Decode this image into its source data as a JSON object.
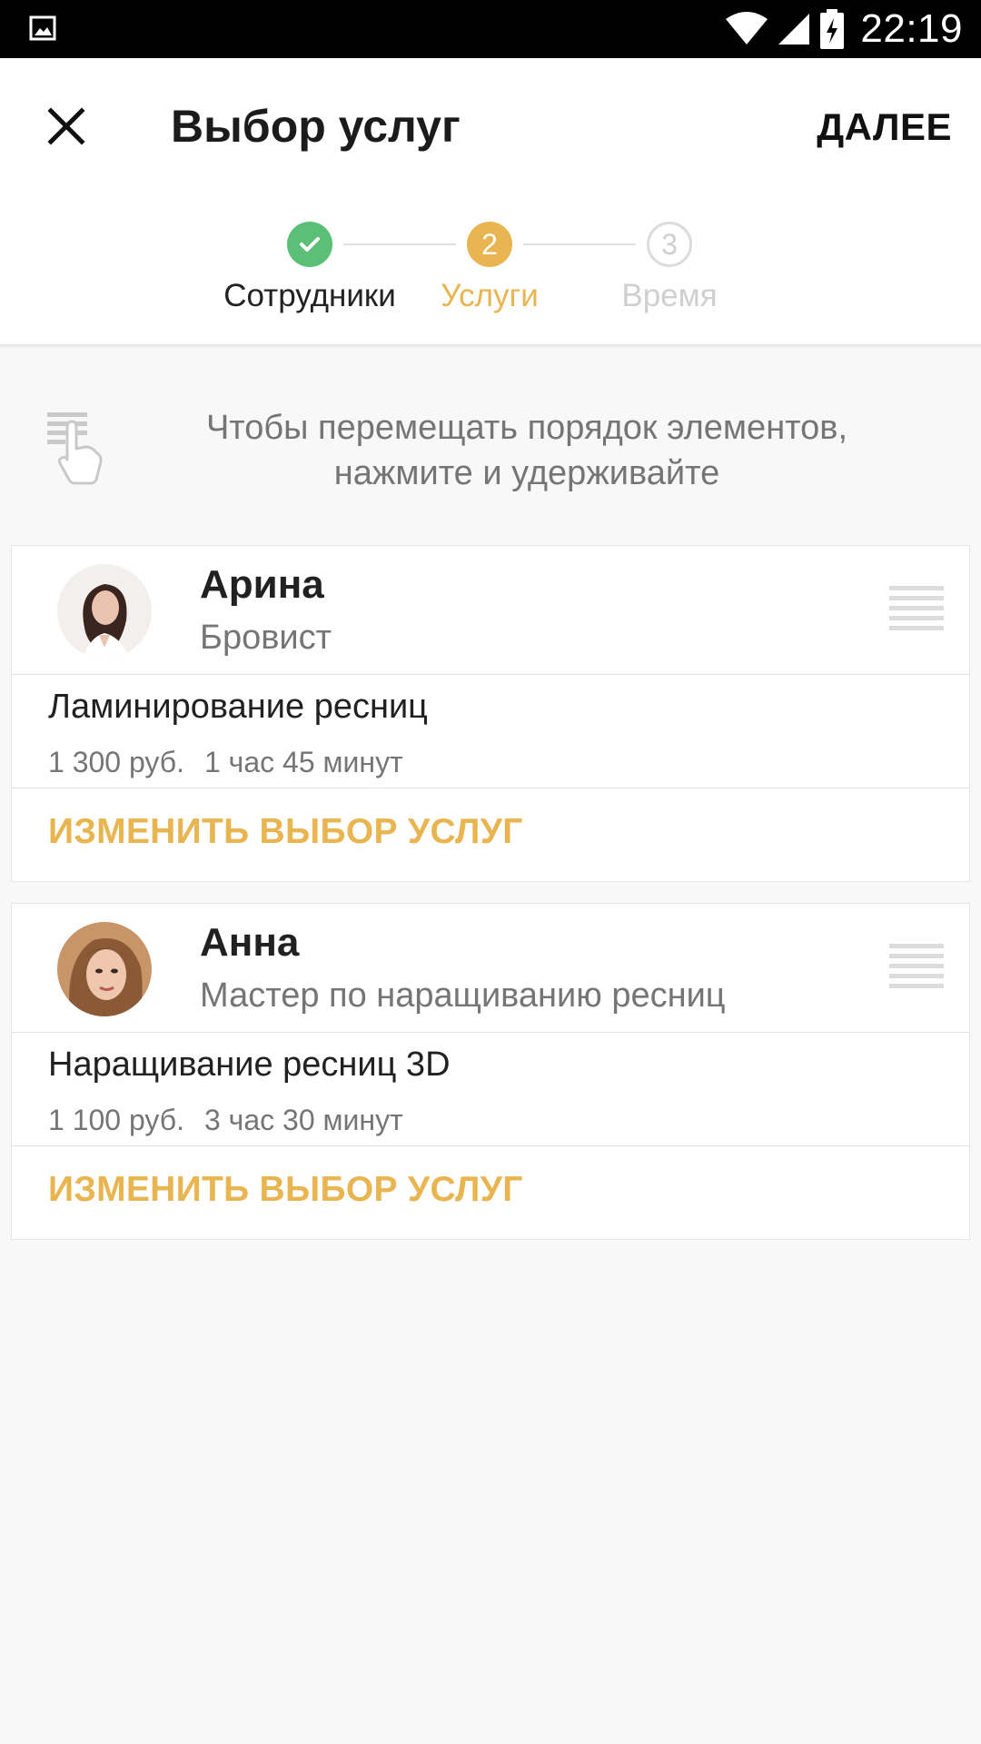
{
  "status_bar": {
    "time": "22:19",
    "icons": [
      "image-icon",
      "wifi-icon",
      "signal-icon",
      "battery-charging-icon"
    ]
  },
  "app_bar": {
    "title": "Выбор услуг",
    "next_label": "ДАЛЕЕ",
    "close_icon": "close-icon"
  },
  "stepper": {
    "steps": [
      {
        "label": "Сотрудники",
        "marker": "",
        "state": "done"
      },
      {
        "label": "Услуги",
        "marker": "2",
        "state": "active"
      },
      {
        "label": "Время",
        "marker": "3",
        "state": "future"
      }
    ]
  },
  "hint": {
    "text_line1": "Чтобы перемещать порядок элементов,",
    "text_line2": "нажмите и удерживайте",
    "icon": "touch-hold-icon"
  },
  "cards": [
    {
      "name": "Арина",
      "role": "Бровист",
      "service_name": "Ламинирование ресниц",
      "price": "1 300 руб.",
      "duration": "1 час 45 минут",
      "change_label": "ИЗМЕНИТЬ ВЫБОР УСЛУГ"
    },
    {
      "name": "Анна",
      "role": "Мастер по наращиванию ресниц",
      "service_name": "Наращивание ресниц 3D",
      "price": "1 100 руб.",
      "duration": "3 час 30 минут",
      "change_label": "ИЗМЕНИТЬ ВЫБОР УСЛУГ"
    }
  ],
  "colors": {
    "accent": "#e8b551",
    "done": "#5cbf77",
    "inactive": "#cfcfcf"
  }
}
